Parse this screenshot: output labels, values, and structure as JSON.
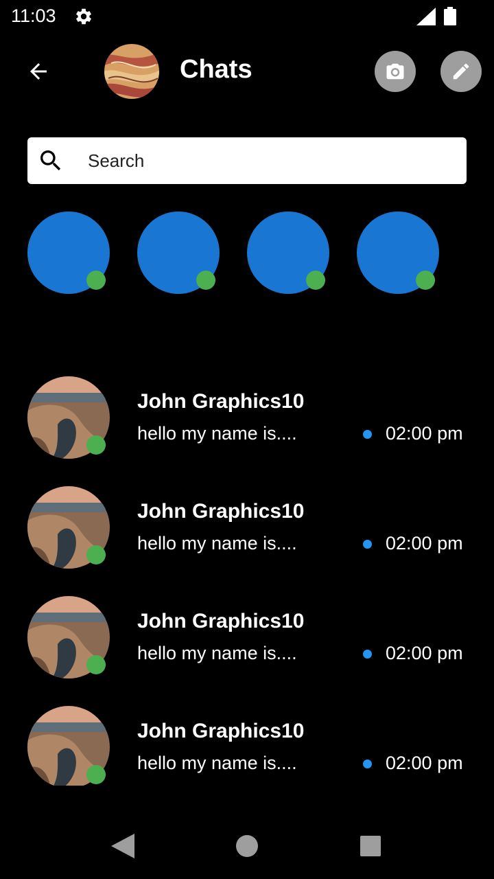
{
  "status_bar": {
    "time": "11:03",
    "icons": [
      "gear-icon",
      "signal-icon",
      "battery-icon"
    ]
  },
  "header": {
    "title": "Chats",
    "back_icon": "arrow-left-icon",
    "camera_icon": "camera-icon",
    "edit_icon": "pencil-icon"
  },
  "search": {
    "placeholder": "Search",
    "icon": "search-icon"
  },
  "stories": {
    "count": 4,
    "color": "#1976d2",
    "online_color": "#4caf50"
  },
  "chats": [
    {
      "name": "John Graphics10",
      "message": "hello my name is....",
      "time": "02:00 pm"
    },
    {
      "name": "John Graphics10",
      "message": "hello my name is....",
      "time": "02:00 pm"
    },
    {
      "name": "John Graphics10",
      "message": "hello my name is....",
      "time": "02:00 pm"
    },
    {
      "name": "John Graphics10",
      "message": "hello my name is....",
      "time": "02:00 pm"
    }
  ],
  "colors": {
    "background": "#000000",
    "accent_blue": "#2196f3",
    "online_green": "#4caf50",
    "button_gray": "#9e9e9e"
  },
  "nav_bar": {
    "icons": [
      "back-triangle-icon",
      "home-circle-icon",
      "recents-square-icon"
    ]
  }
}
